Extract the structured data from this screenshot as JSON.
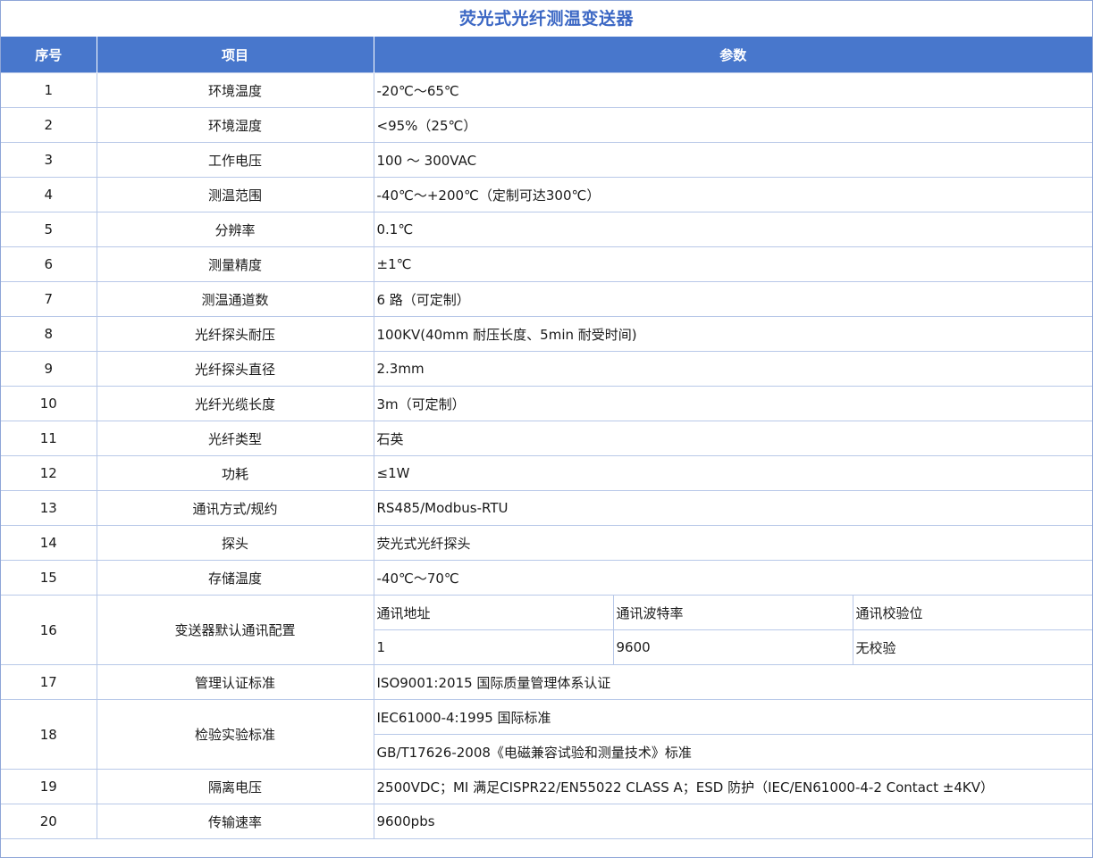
{
  "title": "荧光式光纤测温变送器",
  "headers": {
    "no": "序号",
    "item": "项目",
    "param": "参数"
  },
  "rows": [
    {
      "no": "1",
      "item": "环境温度",
      "value": "-20℃～65℃"
    },
    {
      "no": "2",
      "item": "环境湿度",
      "value": "<95%（25℃）"
    },
    {
      "no": "3",
      "item": "工作电压",
      "value": "100 ～ 300VAC"
    },
    {
      "no": "4",
      "item": "测温范围",
      "value": "-40℃～+200℃（定制可达300℃）"
    },
    {
      "no": "5",
      "item": "分辨率",
      "value": "0.1℃"
    },
    {
      "no": "6",
      "item": "测量精度",
      "value": "±1℃"
    },
    {
      "no": "7",
      "item": "测温通道数",
      "value": "6 路（可定制）"
    },
    {
      "no": "8",
      "item": "光纤探头耐压",
      "value": "100KV(40mm 耐压长度、5min 耐受时间)"
    },
    {
      "no": "9",
      "item": "光纤探头直径",
      "value": "2.3mm"
    },
    {
      "no": "10",
      "item": "光纤光缆长度",
      "value": "3m（可定制）"
    },
    {
      "no": "11",
      "item": "光纤类型",
      "value": "石英"
    },
    {
      "no": "12",
      "item": "功耗",
      "value": "≤1W"
    },
    {
      "no": "13",
      "item": "通讯方式/规约",
      "value": "RS485/Modbus-RTU"
    },
    {
      "no": "14",
      "item": "探头",
      "value": "荧光式光纤探头"
    },
    {
      "no": "15",
      "item": "存储温度",
      "value": "-40℃～70℃"
    }
  ],
  "row16": {
    "no": "16",
    "item": "变送器默认通讯配置",
    "labels": [
      "通讯地址",
      "通讯波特率",
      "通讯校验位"
    ],
    "values": [
      "1",
      "9600",
      "无校验"
    ]
  },
  "row17": {
    "no": "17",
    "item": "管理认证标准",
    "value": "ISO9001:2015 国际质量管理体系认证"
  },
  "row18": {
    "no": "18",
    "item": "检验实验标准",
    "values": [
      "IEC61000-4:1995 国际标准",
      "GB/T17626-2008《电磁兼容试验和测量技术》标准"
    ]
  },
  "row19": {
    "no": "19",
    "item": "隔离电压",
    "value": "2500VDC；MI 满足CISPR22/EN55022 CLASS A；ESD 防护（IEC/EN61000-4-2 Contact ±4KV）"
  },
  "row20": {
    "no": "20",
    "item": "传输速率",
    "value": "9600pbs"
  }
}
